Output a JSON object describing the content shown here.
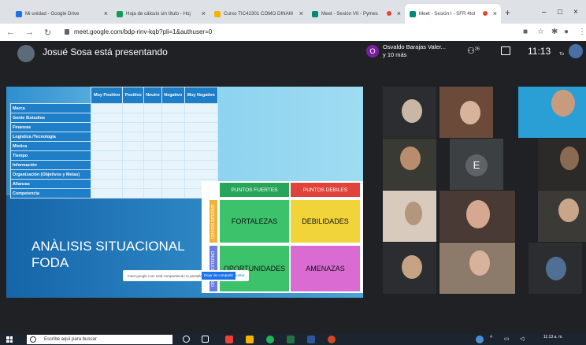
{
  "browser": {
    "tabs": [
      {
        "label": "Mi unidad - Google Drive",
        "color": "#1a73e8",
        "active": false
      },
      {
        "label": "Hoja de cálculo sin título - Hoj",
        "color": "#0f9d58",
        "active": false
      },
      {
        "label": "Curso TIC42301 COMO DINAM",
        "color": "#f4b400",
        "active": false
      },
      {
        "label": "Meet - Sesión VII - Pymes",
        "color": "#00897b",
        "active": false
      },
      {
        "label": "Meet - Sesión I - SFR 4tol",
        "color": "#00897b",
        "active": true
      }
    ],
    "new_tab": "+",
    "url": "meet.google.com/bdp-rinv-kqb?pli=1&authuser=0"
  },
  "meet": {
    "presenter_text": "Josué Sosa está presentando",
    "participant_initial": "O",
    "participant_name": "Osvaldo Barajas Valer...",
    "participant_more": "y 10 más",
    "people_count": "26",
    "clock": "11:13",
    "self_label": "Tú"
  },
  "slide": {
    "table": {
      "headers": [
        "Muy Positivo",
        "Positivo",
        "Neutro",
        "Negativo",
        "Muy Negativo"
      ],
      "rows": [
        "Marca",
        "Gente /Estudios",
        "Finanzas",
        "Logística /Tecnología",
        "Mística",
        "Tiempo",
        "Información",
        "Organización (Objetivos y Metas)",
        "Alianzas",
        "Competencia"
      ]
    },
    "title_line1": "ANÀLISIS SITUACIONAL",
    "title_line2": "FODA",
    "foda": {
      "puntos_fuertes": "PUNTOS FUERTES",
      "puntos_debiles": "PUNTOS DEBILES",
      "fortalezas": "FORTALEZAS",
      "debilidades": "DEBILIDADES",
      "oportunidades": "OPORTUNIDADES",
      "amenazas": "AMENAZAS",
      "origen_interno": "ORIGEN INTERNO",
      "origen_externo": "ORIGEN EXTERNO"
    },
    "notification": {
      "text": "meet.google.com está compartiendo tu pantalla.",
      "stop": "Dejar de compartir",
      "hide": "Ocultar"
    }
  },
  "taskbar": {
    "search_placeholder": "Escribe aquí para buscar",
    "time": "11:13 a. m."
  },
  "colors": {
    "fortalezas": "#3cc26b",
    "debilidades": "#f0d43a",
    "oportunidades": "#3cc26b",
    "amenazas": "#d96bd3",
    "head_green": "#27a55a",
    "head_red": "#e0433b"
  }
}
